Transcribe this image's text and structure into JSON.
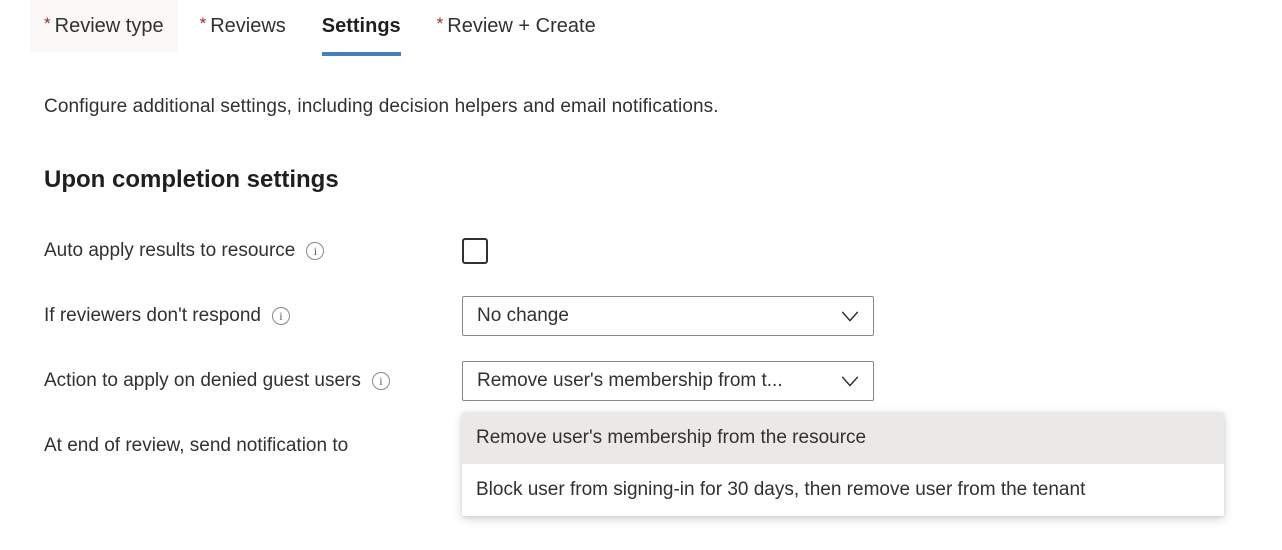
{
  "tabs": [
    {
      "label": "Review type",
      "required": true,
      "selected": false,
      "hovered": true
    },
    {
      "label": "Reviews",
      "required": true,
      "selected": false,
      "hovered": false
    },
    {
      "label": "Settings",
      "required": false,
      "selected": true,
      "hovered": false
    },
    {
      "label": "Review + Create",
      "required": true,
      "selected": false,
      "hovered": false
    }
  ],
  "required_marker": "*",
  "intro": "Configure additional settings, including decision helpers and email notifications.",
  "section": {
    "title": "Upon completion settings"
  },
  "rows": {
    "auto_apply": {
      "label": "Auto apply results to resource",
      "info_icon": "info-icon",
      "info_glyph": "i",
      "checkbox_checked": false
    },
    "no_respond": {
      "label": "If reviewers don't respond",
      "info_icon": "info-icon",
      "info_glyph": "i",
      "value": "No change"
    },
    "denied_guests": {
      "label": "Action to apply on denied guest users",
      "info_icon": "info-icon",
      "info_glyph": "i",
      "value": "Remove user's membership from t..."
    },
    "notify": {
      "label": "At end of review, send notification to"
    }
  },
  "denied_guests_options": [
    {
      "label": "Remove user's membership from the resource",
      "highlighted": true
    },
    {
      "label": "Block user from signing-in for 30 days, then remove user from the tenant",
      "highlighted": false
    }
  ],
  "colors": {
    "accent": "#4a7ebb",
    "required_asterisk": "#a4262c",
    "text": "#323130",
    "option_highlight": "#ebe9e7",
    "tab_hover": "#faf9f8"
  }
}
